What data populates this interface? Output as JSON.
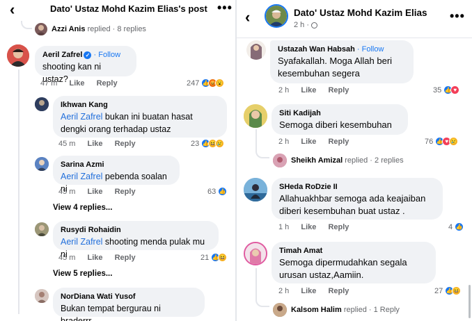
{
  "left": {
    "header": {
      "back_icon": "arrow-left-icon",
      "title": "Dato' Ustaz Mohd Kazim Elias's post",
      "more": "•••"
    },
    "reply_summary": {
      "name": "Azzi Anis",
      "text": "replied · 8 replies"
    },
    "main_comment": {
      "name": "Aeril Zafrel",
      "follow": "Follow",
      "separator": "·",
      "text": "shooting kan ni ustaz?",
      "time": "47 m",
      "like": "Like",
      "reply": "Reply",
      "count": "247"
    },
    "replies": [
      {
        "name": "Ikhwan Kang",
        "tag": "Aeril Zafrel",
        "text": " bukan ini buatan hasat dengki orang terhadap ustaz",
        "time": "45 m",
        "like": "Like",
        "reply": "Reply",
        "count": "23"
      },
      {
        "name": "Sarina Azmi",
        "tag": "Aeril Zafrel",
        "text": " pebenda soalan ni",
        "time": "45 m",
        "like": "Like",
        "reply": "Reply",
        "count": "63",
        "view_more": "View 4 replies..."
      },
      {
        "name": "Rusydi Rohaidin",
        "tag": "Aeril Zafrel",
        "text": " shooting menda pulak mu ni",
        "time": "45 m",
        "like": "Like",
        "reply": "Reply",
        "count": "21",
        "view_more": "View 5 replies..."
      },
      {
        "name": "NorDiana Wati Yusof",
        "text": "Bukan tempat bergurau ni braderrr.."
      }
    ]
  },
  "right": {
    "header": {
      "back_icon": "arrow-left-icon",
      "title": "Dato' Ustaz Mohd Kazim Elias",
      "time": "2 h ·",
      "more": "•••"
    },
    "comments": [
      {
        "name": "Ustazah Wan Habsah",
        "follow": "Follow",
        "separator": "·",
        "text": "Syafakallah. Moga Allah beri kesembuhan segera",
        "time": "2 h",
        "like": "Like",
        "reply": "Reply",
        "count": "35"
      },
      {
        "name": "Siti Kadijah",
        "text": "Semoga diberi kesembuhan",
        "time": "2 h",
        "like": "Like",
        "reply": "Reply",
        "count": "76",
        "reply_summary": {
          "name": "Sheikh Amizal",
          "text": "replied · 2 replies"
        }
      },
      {
        "name": "SHeda RoDzie II",
        "text": "Allahuakhbar semoga ada keajaiban diberi kesembuhan buat ustaz .",
        "time": "1 h",
        "like": "Like",
        "reply": "Reply",
        "count": "4"
      },
      {
        "name": "Timah Amat",
        "text": "Semoga dipermudahkan segala urusan ustaz,Aamiin.",
        "time": "2 h",
        "like": "Like",
        "reply": "Reply",
        "count": "27",
        "reply_summary": {
          "name": "Kalsom Halim",
          "text": "replied · 1 Reply"
        }
      }
    ]
  },
  "colors": {
    "link": "#216fdb",
    "like": "#1877f2",
    "love": "#f33e58",
    "bubble": "#f0f2f5",
    "meta": "#65676b"
  }
}
